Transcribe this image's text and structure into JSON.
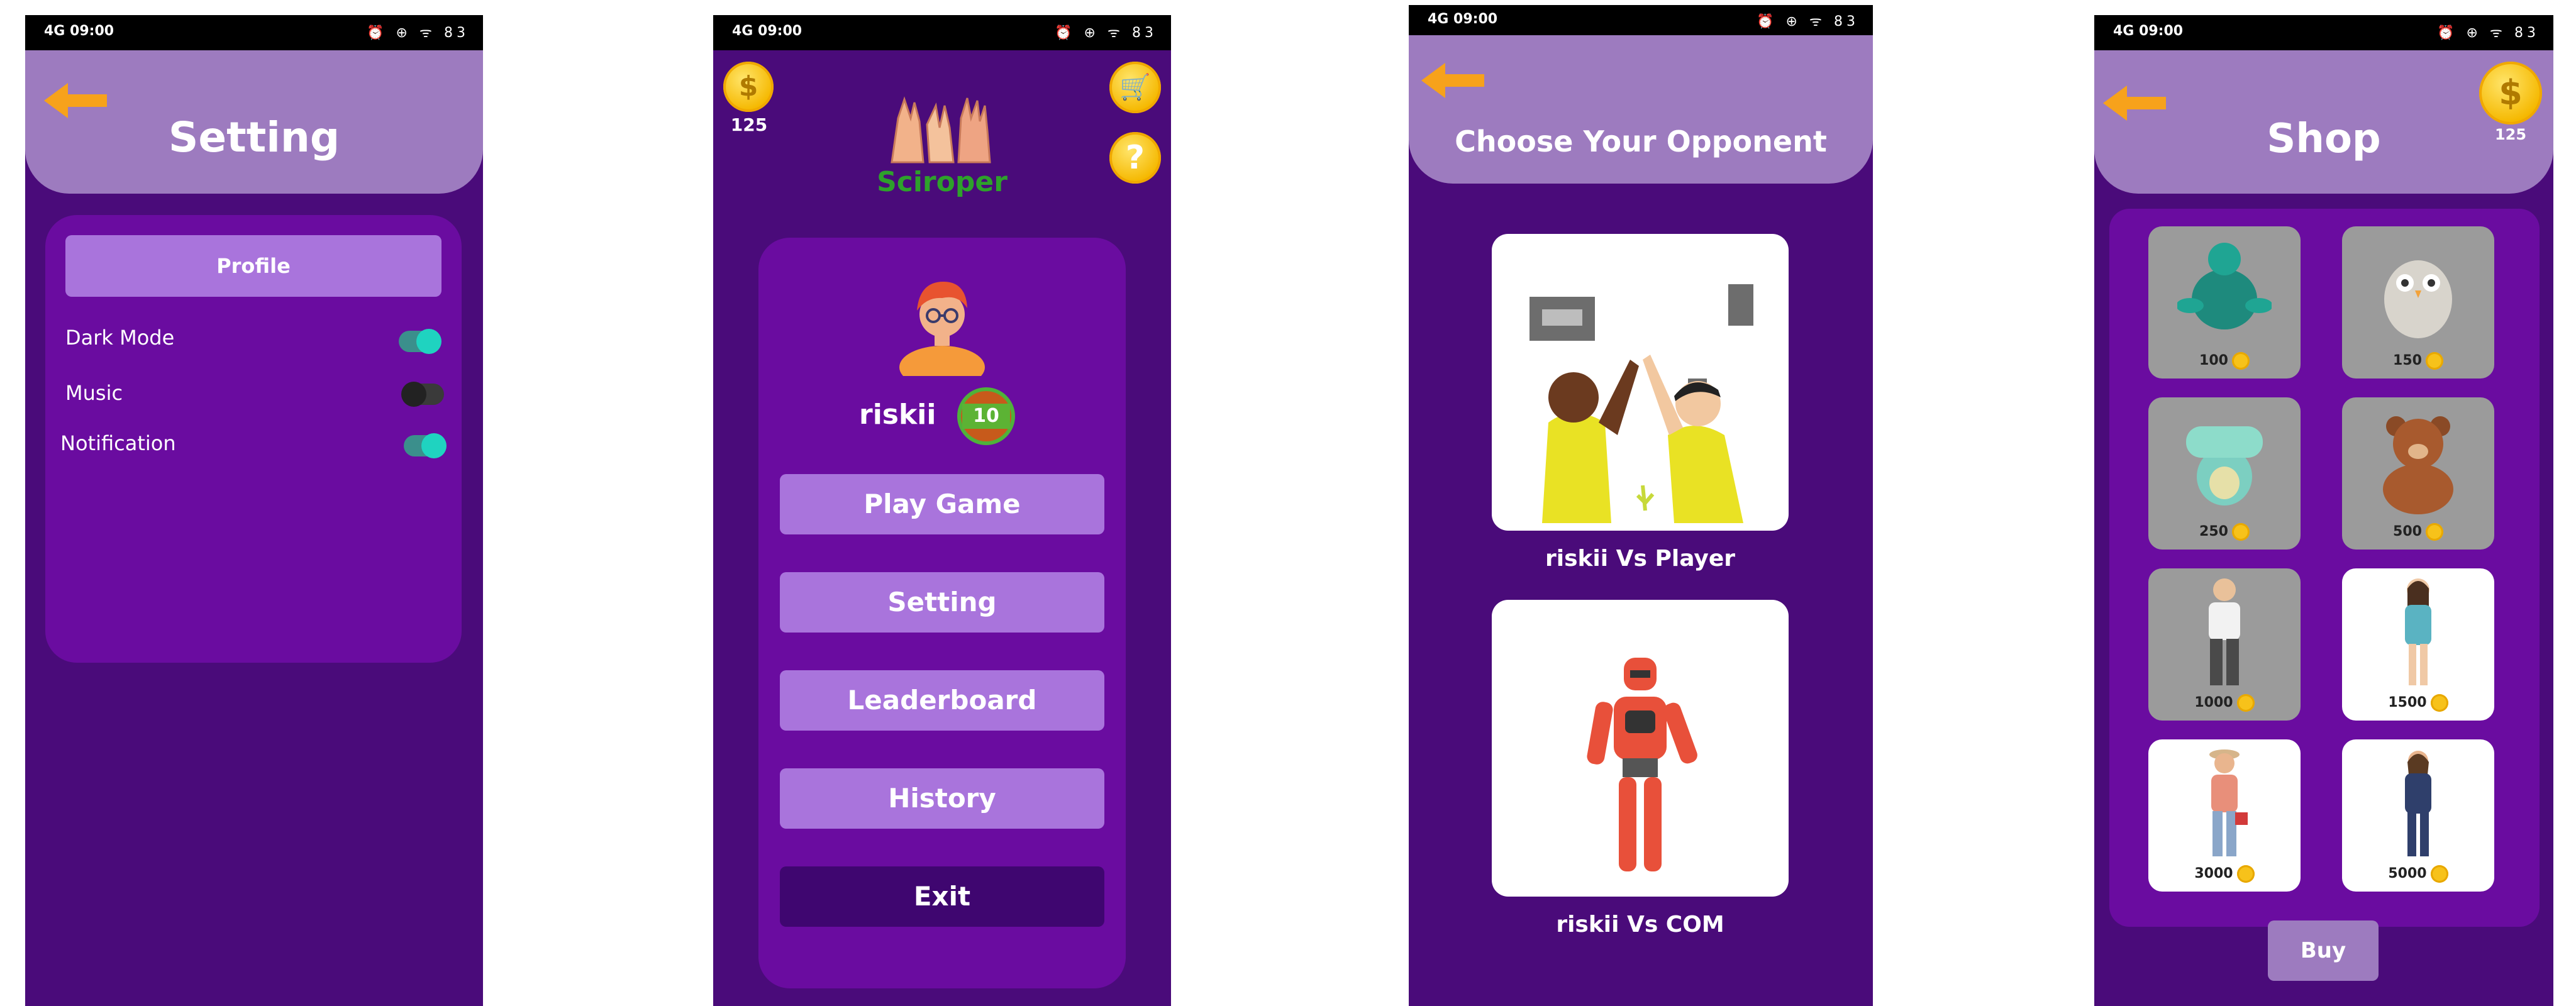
{
  "status_bar": {
    "time": "09:00",
    "network": "4G",
    "icons_right": "⏰ ⊕ ᯤ 83"
  },
  "setting_screen": {
    "title": "Setting",
    "profile_button": "Profile",
    "options": [
      {
        "label": "Dark Mode",
        "state": "on"
      },
      {
        "label": "Music",
        "state": "off"
      },
      {
        "label": "Notification",
        "state": "on"
      }
    ]
  },
  "menu_screen": {
    "coins": "125",
    "logo_text": "Sciroper",
    "username": "riskii",
    "level": "10",
    "buttons": [
      "Play Game",
      "Setting",
      "Leaderboard",
      "History",
      "Exit"
    ]
  },
  "opponent_screen": {
    "title": "Choose Your Opponent",
    "options": [
      "riskii Vs Player",
      "riskii Vs COM"
    ]
  },
  "shop_screen": {
    "title": "Shop",
    "coins": "125",
    "items": [
      {
        "name": "turtle",
        "price": "100",
        "bg": "gray"
      },
      {
        "name": "owl",
        "price": "150",
        "bg": "gray"
      },
      {
        "name": "crocodile",
        "price": "250",
        "bg": "gray"
      },
      {
        "name": "bear",
        "price": "500",
        "bg": "gray"
      },
      {
        "name": "old-man",
        "price": "1000",
        "bg": "gray"
      },
      {
        "name": "girl",
        "price": "1500",
        "bg": "white"
      },
      {
        "name": "explorer",
        "price": "3000",
        "bg": "white"
      },
      {
        "name": "businesswoman",
        "price": "5000",
        "bg": "white"
      }
    ],
    "buy_button": "Buy"
  },
  "colors": {
    "background": "#4a0b7a",
    "header": "#9d7bbf",
    "panel": "#6a0ca0",
    "button": "#a974dc",
    "coin": "#f5b800"
  }
}
